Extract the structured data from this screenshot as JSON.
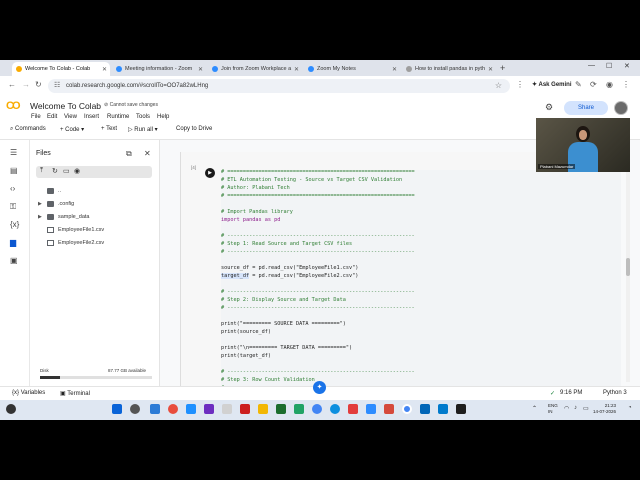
{
  "browser": {
    "tabs": [
      {
        "label": "Welcome To Colab - Colab",
        "active": true,
        "color": "#f9ab00"
      },
      {
        "label": "Meeting information - Zoom",
        "active": false,
        "color": "#2d8cff"
      },
      {
        "label": "Join from Zoom Workplace a",
        "active": false,
        "color": "#2d8cff"
      },
      {
        "label": "Zoom My Notes",
        "active": false,
        "color": "#2d8cff"
      },
      {
        "label": "How to install pandas in pyth",
        "active": false,
        "color": "#9e9e9e"
      }
    ],
    "new_tab": "+",
    "url": "colab.research.google.com/#scrollTo=OO7a82wLHng",
    "ask_gemini": "Ask Gemini"
  },
  "colab": {
    "logo": "CO",
    "title": "Welcome To Colab",
    "save_status": "Cannot save changes",
    "menus": [
      "File",
      "Edit",
      "View",
      "Insert",
      "Runtime",
      "Tools",
      "Help"
    ],
    "toolbar": {
      "commands": "Commands",
      "code": "+ Code",
      "text": "+ Text",
      "run_all": "Run all",
      "copy_to_drive": "Copy to Drive"
    },
    "share": "Share"
  },
  "files_panel": {
    "title": "Files",
    "items": [
      {
        "name": "..",
        "type": "folder",
        "expandable": false
      },
      {
        "name": ".config",
        "type": "folder",
        "expandable": true
      },
      {
        "name": "sample_data",
        "type": "folder",
        "expandable": true
      },
      {
        "name": "EmployeeFile1.csv",
        "type": "file",
        "expandable": false
      },
      {
        "name": "EmployeeFile2.csv",
        "type": "file",
        "expandable": false
      }
    ],
    "disk_label": "Disk",
    "disk_available": "87.77 GB available",
    "disk_used_fraction": 0.18
  },
  "cell": {
    "exec_count": "[4]",
    "lines": [
      {
        "cls": "c-cmt",
        "text": "# ============================================================"
      },
      {
        "cls": "c-cmt",
        "text": "# ETL Automation Testing - Source vs Target CSV Validation"
      },
      {
        "cls": "c-cmt",
        "text": "# Author: Plabani Tech"
      },
      {
        "cls": "c-cmt",
        "text": "# ============================================================"
      },
      {
        "cls": "c-plain",
        "text": ""
      },
      {
        "cls": "c-cmt",
        "text": "# Import Pandas library"
      },
      {
        "cls": "c-kw",
        "text": "import pandas as pd"
      },
      {
        "cls": "c-plain",
        "text": ""
      },
      {
        "cls": "c-cmt",
        "text": "# ------------------------------------------------------------"
      },
      {
        "cls": "c-cmt",
        "text": "# Step 1: Read Source and Target CSV files"
      },
      {
        "cls": "c-cmt",
        "text": "# ------------------------------------------------------------"
      },
      {
        "cls": "c-plain",
        "text": ""
      },
      {
        "cls": "c-plain",
        "text": "source_df = pd.read_csv(\"EmployeeFile1.csv\")"
      },
      {
        "cls": "c-plain hl-first",
        "text": "target_df = pd.read_csv(\"EmployeeFile2.csv\")"
      },
      {
        "cls": "c-plain",
        "text": ""
      },
      {
        "cls": "c-cmt",
        "text": "# ------------------------------------------------------------"
      },
      {
        "cls": "c-cmt",
        "text": "# Step 2: Display Source and Target Data"
      },
      {
        "cls": "c-cmt",
        "text": "# ------------------------------------------------------------"
      },
      {
        "cls": "c-plain",
        "text": ""
      },
      {
        "cls": "c-plain",
        "text": "print(\"========= SOURCE DATA =========\")"
      },
      {
        "cls": "c-plain",
        "text": "print(source_df)"
      },
      {
        "cls": "c-plain",
        "text": ""
      },
      {
        "cls": "c-plain",
        "text": "print(\"\\n========= TARGET DATA =========\")"
      },
      {
        "cls": "c-plain",
        "text": "print(target_df)"
      },
      {
        "cls": "c-plain",
        "text": ""
      },
      {
        "cls": "c-cmt",
        "text": "# ------------------------------------------------------------"
      },
      {
        "cls": "c-cmt",
        "text": "# Step 3: Row Count Validation"
      },
      {
        "cls": "c-cmt",
        "text": "# ------------------------------------------------------------"
      }
    ]
  },
  "video": {
    "name": "Plabani Mazumdar"
  },
  "statusbar": {
    "variables": "Variables",
    "terminal": "Terminal",
    "time": "9:16 PM",
    "runtime": "Python 3"
  },
  "taskbar": {
    "lang": "ENG",
    "region": "IN",
    "time": "21:23",
    "date": "14-07-2026"
  }
}
